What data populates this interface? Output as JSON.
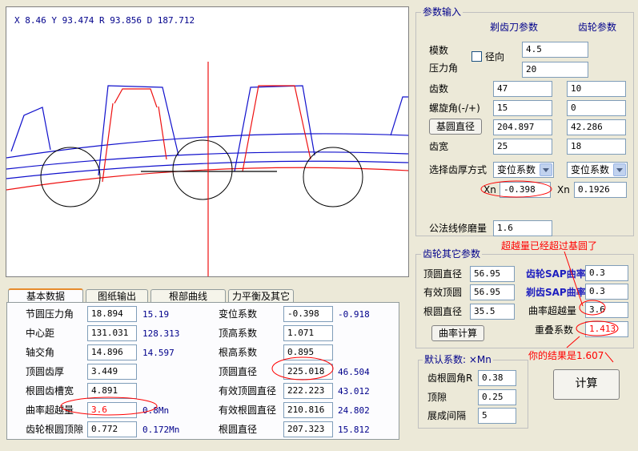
{
  "canvas": {
    "coord_readout": "X 8.46   Y 93.474  R 93.856 D 187.712"
  },
  "params_input": {
    "title": "参数输入",
    "col_cutter": "剃齿刀参数",
    "col_gear": "齿轮参数",
    "module_label": "模数",
    "module_value": "4.5",
    "radial_label": "径向",
    "pressure_label": "压力角",
    "pressure_value": "20",
    "teeth_label": "齿数",
    "teeth_cutter": "47",
    "teeth_gear": "10",
    "helix_label": "螺旋角(-/+)",
    "helix_cutter": "15",
    "helix_gear": "0",
    "base_btn": "基圆直径",
    "base_cutter": "204.897",
    "base_gear": "42.286",
    "width_label": "齿宽",
    "width_cutter": "25",
    "width_gear": "18",
    "thickness_label": "选择齿厚方式",
    "combo_cutter": "变位系数",
    "combo_gear": "变位系数",
    "xn_label": "Xn",
    "xn_cutter": "-0.398",
    "xn_gear": "0.1926",
    "normal_label": "公法线修磨量",
    "normal_value": "1.6"
  },
  "gear_other": {
    "title": "齿轮其它参数",
    "tip_dia_label": "顶圆直径",
    "tip_dia": "56.95",
    "eff_tip_label": "有效顶圆",
    "eff_tip": "56.95",
    "root_dia_label": "根圆直径",
    "root_dia": "35.5",
    "curv_btn": "曲率计算",
    "gear_sap_label": "齿轮SAP曲率",
    "gear_sap": "0.3",
    "cutter_sap_label": "剃齿SAP曲率",
    "cutter_sap": "0.3",
    "overtravel_label": "曲率超越量",
    "overtravel": "3.6",
    "overlap_label": "重叠系数",
    "overlap": "1.413"
  },
  "defaults": {
    "title": "默认系数: ×Mn",
    "root_fillet_label": "齿根圆角R",
    "root_fillet": "0.38",
    "clearance_label": "顶隙",
    "clearance": "0.25",
    "gap_label": "展成间隔",
    "gap": "5"
  },
  "calc_btn": "计算",
  "tabs": [
    "基本数据",
    "图纸输出",
    "根部曲线",
    "力平衡及其它"
  ],
  "basic": {
    "left": [
      {
        "label": "节圆压力角",
        "box": "18.894",
        "extra": "15.19"
      },
      {
        "label": "中心距",
        "box": "131.031",
        "extra": "128.313"
      },
      {
        "label": "轴交角",
        "box": "14.896",
        "extra": "14.597"
      },
      {
        "label": "顶圆齿厚",
        "box": "3.449",
        "extra": ""
      },
      {
        "label": "根圆齿槽宽",
        "box": "4.891",
        "extra": ""
      },
      {
        "label": "曲率超越量",
        "box": "3.6",
        "extra": "0.8Mn"
      },
      {
        "label": "齿轮根圆顶隙",
        "box": "0.772",
        "extra": "0.172Mn"
      }
    ],
    "right": [
      {
        "label": "变位系数",
        "box": "-0.398",
        "extra": "-0.918"
      },
      {
        "label": "顶高系数",
        "box": "1.071",
        "extra": ""
      },
      {
        "label": "根高系数",
        "box": "0.895",
        "extra": ""
      },
      {
        "label": "顶圆直径",
        "box": "225.018",
        "extra": "46.504"
      },
      {
        "label": "有效顶圆直径",
        "box": "222.223",
        "extra": "43.012"
      },
      {
        "label": "有效根圆直径",
        "box": "210.816",
        "extra": "24.802"
      },
      {
        "label": "根圆直径",
        "box": "207.323",
        "extra": "15.812"
      }
    ]
  },
  "annotations": {
    "over_base": "超越量已经超过基圆了",
    "your_result": "你的结果是1.607"
  },
  "colors": {
    "accent_red": "#ff0000",
    "navy": "#00008b",
    "gear_blue": "#1010cc"
  }
}
